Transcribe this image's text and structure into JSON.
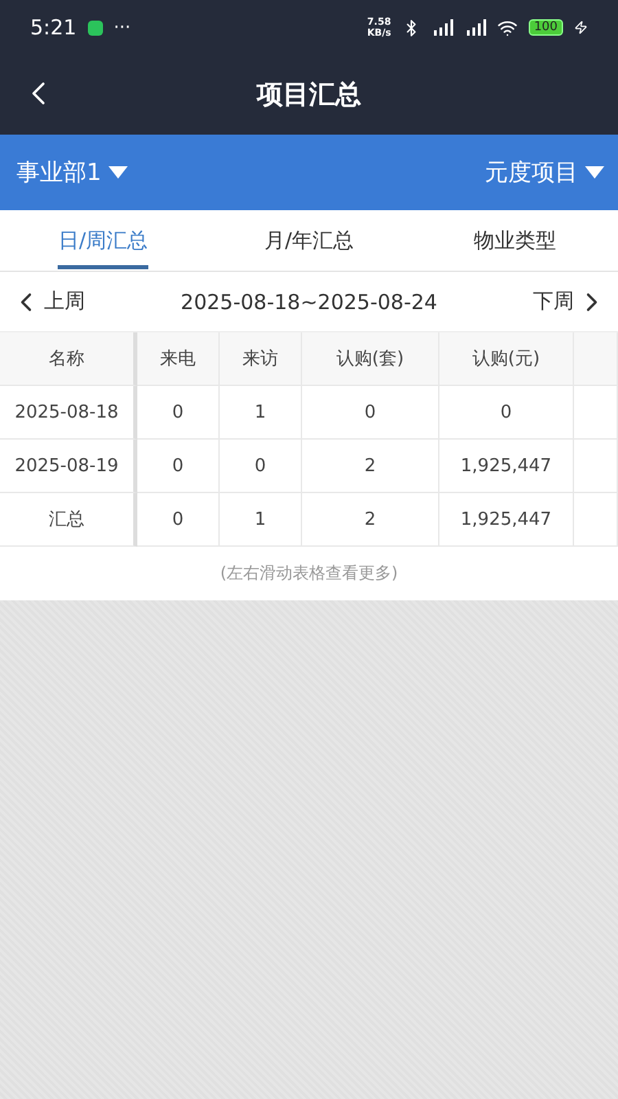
{
  "status_bar": {
    "time": "5:21",
    "more": "···",
    "speed": "7.58\nKB/s",
    "battery": "100"
  },
  "header": {
    "title": "项目汇总"
  },
  "filters": [
    {
      "label": "事业部1"
    },
    {
      "label": "元度项目"
    }
  ],
  "tabs": [
    {
      "label": "日/周汇总",
      "selected": true
    },
    {
      "label": "月/年汇总",
      "selected": false
    },
    {
      "label": "物业类型",
      "selected": false
    }
  ],
  "week": {
    "prev": "上周",
    "range": "2025-08-18~2025-08-24",
    "next": "下周"
  },
  "table": {
    "columns": [
      "名称",
      "来电",
      "来访",
      "认购(套)",
      "认购(元)"
    ],
    "rows": [
      [
        "2025-08-18",
        "0",
        "1",
        "0",
        "0"
      ],
      [
        "2025-08-19",
        "0",
        "0",
        "2",
        "1,925,447"
      ],
      [
        "汇总",
        "0",
        "1",
        "2",
        "1,925,447"
      ]
    ]
  },
  "hint": "(左右滑动表格查看更多)"
}
